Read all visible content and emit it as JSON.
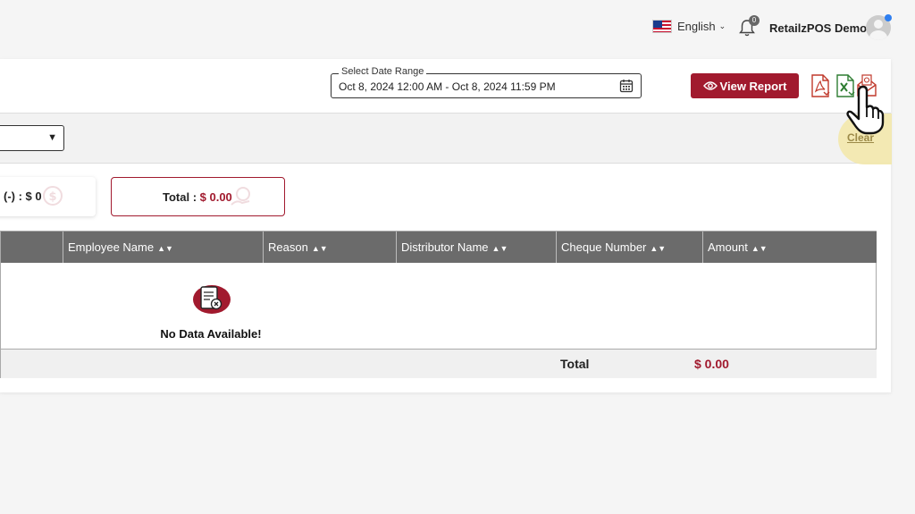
{
  "topbar": {
    "language": "English",
    "notification_count": "0",
    "user_name": "RetailzPOS Demo"
  },
  "report": {
    "date_range_label": "Select Date Range",
    "date_range_value": "Oct 8, 2024 12:00 AM - Oct 8, 2024 11:59 PM",
    "view_report_label": "View Report",
    "clear_label": "Clear",
    "summary_left": "(-) : $ 0",
    "summary_total_label": "Total : ",
    "summary_total_value": "$ 0.00"
  },
  "table": {
    "columns": [
      "Employee Name",
      "Reason",
      "Distributor Name",
      "Cheque Number",
      "Amount"
    ],
    "empty_message": "No Data Available!",
    "footer_label": "Total",
    "footer_value": "$ 0.00"
  },
  "colors": {
    "brand": "#a11a2e",
    "header_bg": "#6b6b6b"
  }
}
